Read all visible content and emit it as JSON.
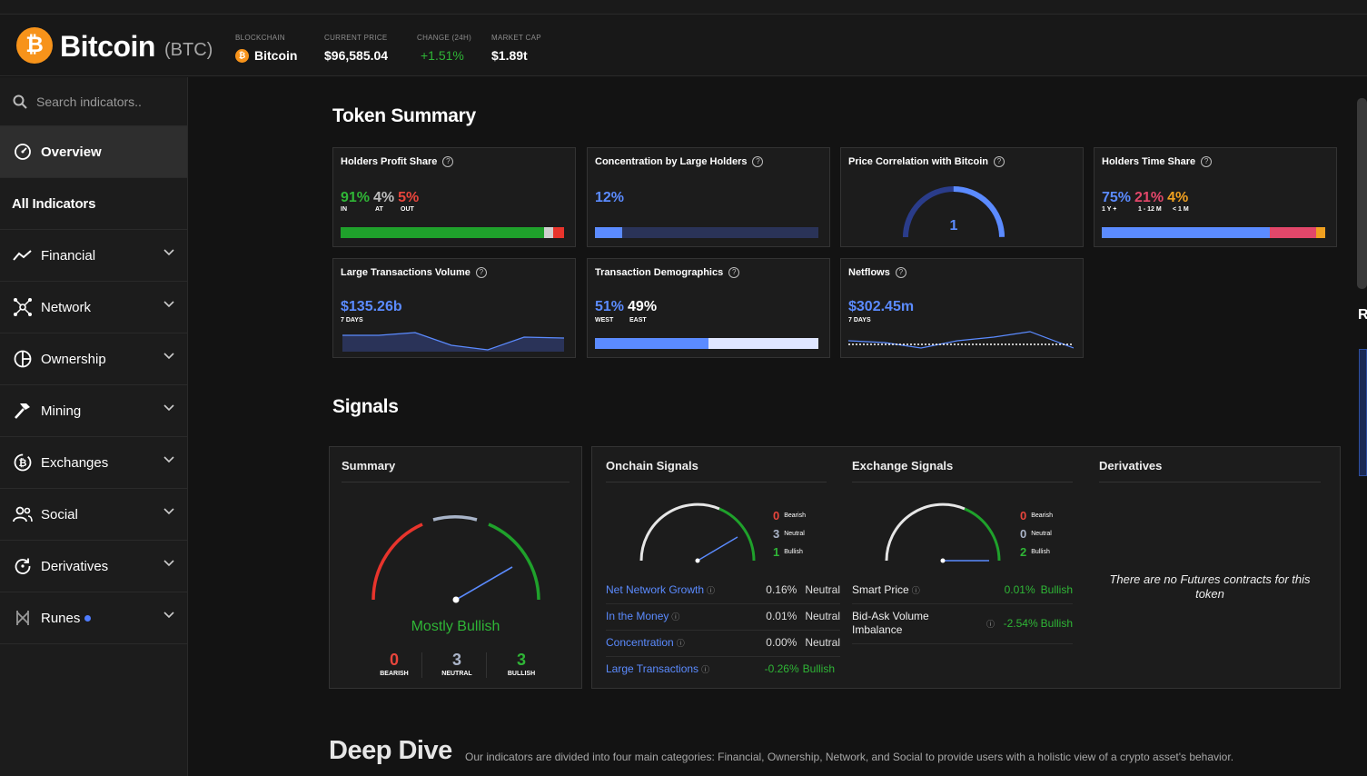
{
  "header": {
    "logo_glyph": "₿",
    "coin_name": "Bitcoin",
    "coin_symbol": "(BTC)",
    "blockchain_label": "BLOCKCHAIN",
    "blockchain_value": "Bitcoin",
    "price_label": "CURRENT PRICE",
    "price_value": "$96,585.04",
    "change_label": "CHANGE (24H)",
    "change_value": "+1.51%",
    "mcap_label": "MARKET CAP",
    "mcap_value": "$1.89t"
  },
  "sidebar": {
    "search_placeholder": "Search indicators..",
    "overview": "Overview",
    "all_indicators": "All Indicators",
    "items": [
      {
        "label": "Financial",
        "icon": "chart-line-icon"
      },
      {
        "label": "Network",
        "icon": "network-icon"
      },
      {
        "label": "Ownership",
        "icon": "pie-icon"
      },
      {
        "label": "Mining",
        "icon": "hammer-icon"
      },
      {
        "label": "Exchanges",
        "icon": "exchange-icon"
      },
      {
        "label": "Social",
        "icon": "users-icon"
      },
      {
        "label": "Derivatives",
        "icon": "refresh-icon"
      },
      {
        "label": "Runes",
        "icon": "runes-icon"
      }
    ]
  },
  "token_summary": {
    "heading": "Token Summary",
    "holders_profit": {
      "title": "Holders Profit Share",
      "in": "91%",
      "at": "4%",
      "out": "5%",
      "in_label": "IN",
      "at_label": "AT",
      "out_label": "OUT",
      "in_frac": 0.91,
      "at_frac": 0.04,
      "out_frac": 0.05
    },
    "concentration": {
      "title": "Concentration by Large Holders",
      "value": "12%",
      "frac": 0.12
    },
    "correlation": {
      "title": "Price Correlation with Bitcoin",
      "value": "1"
    },
    "time_share": {
      "title": "Holders Time Share",
      "a": "75%",
      "b": "21%",
      "c": "4%",
      "a_label": "1 Y +",
      "b_label": "1 - 12 M",
      "c_label": "< 1 M",
      "a_frac": 0.75,
      "b_frac": 0.21,
      "c_frac": 0.04
    },
    "large_tx": {
      "title": "Large Transactions Volume",
      "value": "$135.26b",
      "sub": "7 DAYS"
    },
    "demographics": {
      "title": "Transaction Demographics",
      "west": "51%",
      "east": "49%",
      "west_label": "WEST",
      "east_label": "EAST",
      "west_frac": 0.51
    },
    "netflows": {
      "title": "Netflows",
      "value": "$302.45m",
      "sub": "7 DAYS"
    }
  },
  "signals": {
    "heading": "Signals",
    "summary": {
      "title": "Summary",
      "verdict": "Mostly Bullish",
      "bearish": "0",
      "neutral": "3",
      "bullish": "3",
      "bearish_label": "BEARISH",
      "neutral_label": "NEUTRAL",
      "bullish_label": "BULLISH"
    },
    "onchain": {
      "title": "Onchain Signals",
      "bearish": "0",
      "neutral": "3",
      "bullish": "1",
      "bearish_label": "Bearish",
      "neutral_label": "Neutral",
      "bullish_label": "Bullish",
      "rows": [
        {
          "name": "Net Network Growth",
          "value": "0.16%",
          "status": "Neutral"
        },
        {
          "name": "In the Money",
          "value": "0.01%",
          "status": "Neutral"
        },
        {
          "name": "Concentration",
          "value": "0.00%",
          "status": "Neutral"
        },
        {
          "name": "Large Transactions",
          "value": "-0.26%",
          "status": "Bullish"
        }
      ]
    },
    "exchange": {
      "title": "Exchange Signals",
      "bearish": "0",
      "neutral": "0",
      "bullish": "2",
      "bearish_label": "Bearish",
      "neutral_label": "Neutral",
      "bullish_label": "Bullish",
      "rows": [
        {
          "name": "Smart Price",
          "value": "0.01%",
          "status": "Bullish"
        },
        {
          "name": "Bid-Ask Volume Imbalance",
          "value": "-2.54%",
          "status": "Bullish"
        }
      ]
    },
    "derivatives": {
      "title": "Derivatives",
      "empty_text": "There are no Futures contracts for this token"
    }
  },
  "deep_dive": {
    "heading": "Deep Dive",
    "text": "Our indicators are divided into four main categories: Financial, Ownership, Network, and Social to provide users with a holistic view of a crypto asset's behavior."
  },
  "colors": {
    "accent_blue": "#5b8bff",
    "bull_green": "#2fb536",
    "bear_red": "#e8453c",
    "btc_orange": "#f7931a"
  }
}
